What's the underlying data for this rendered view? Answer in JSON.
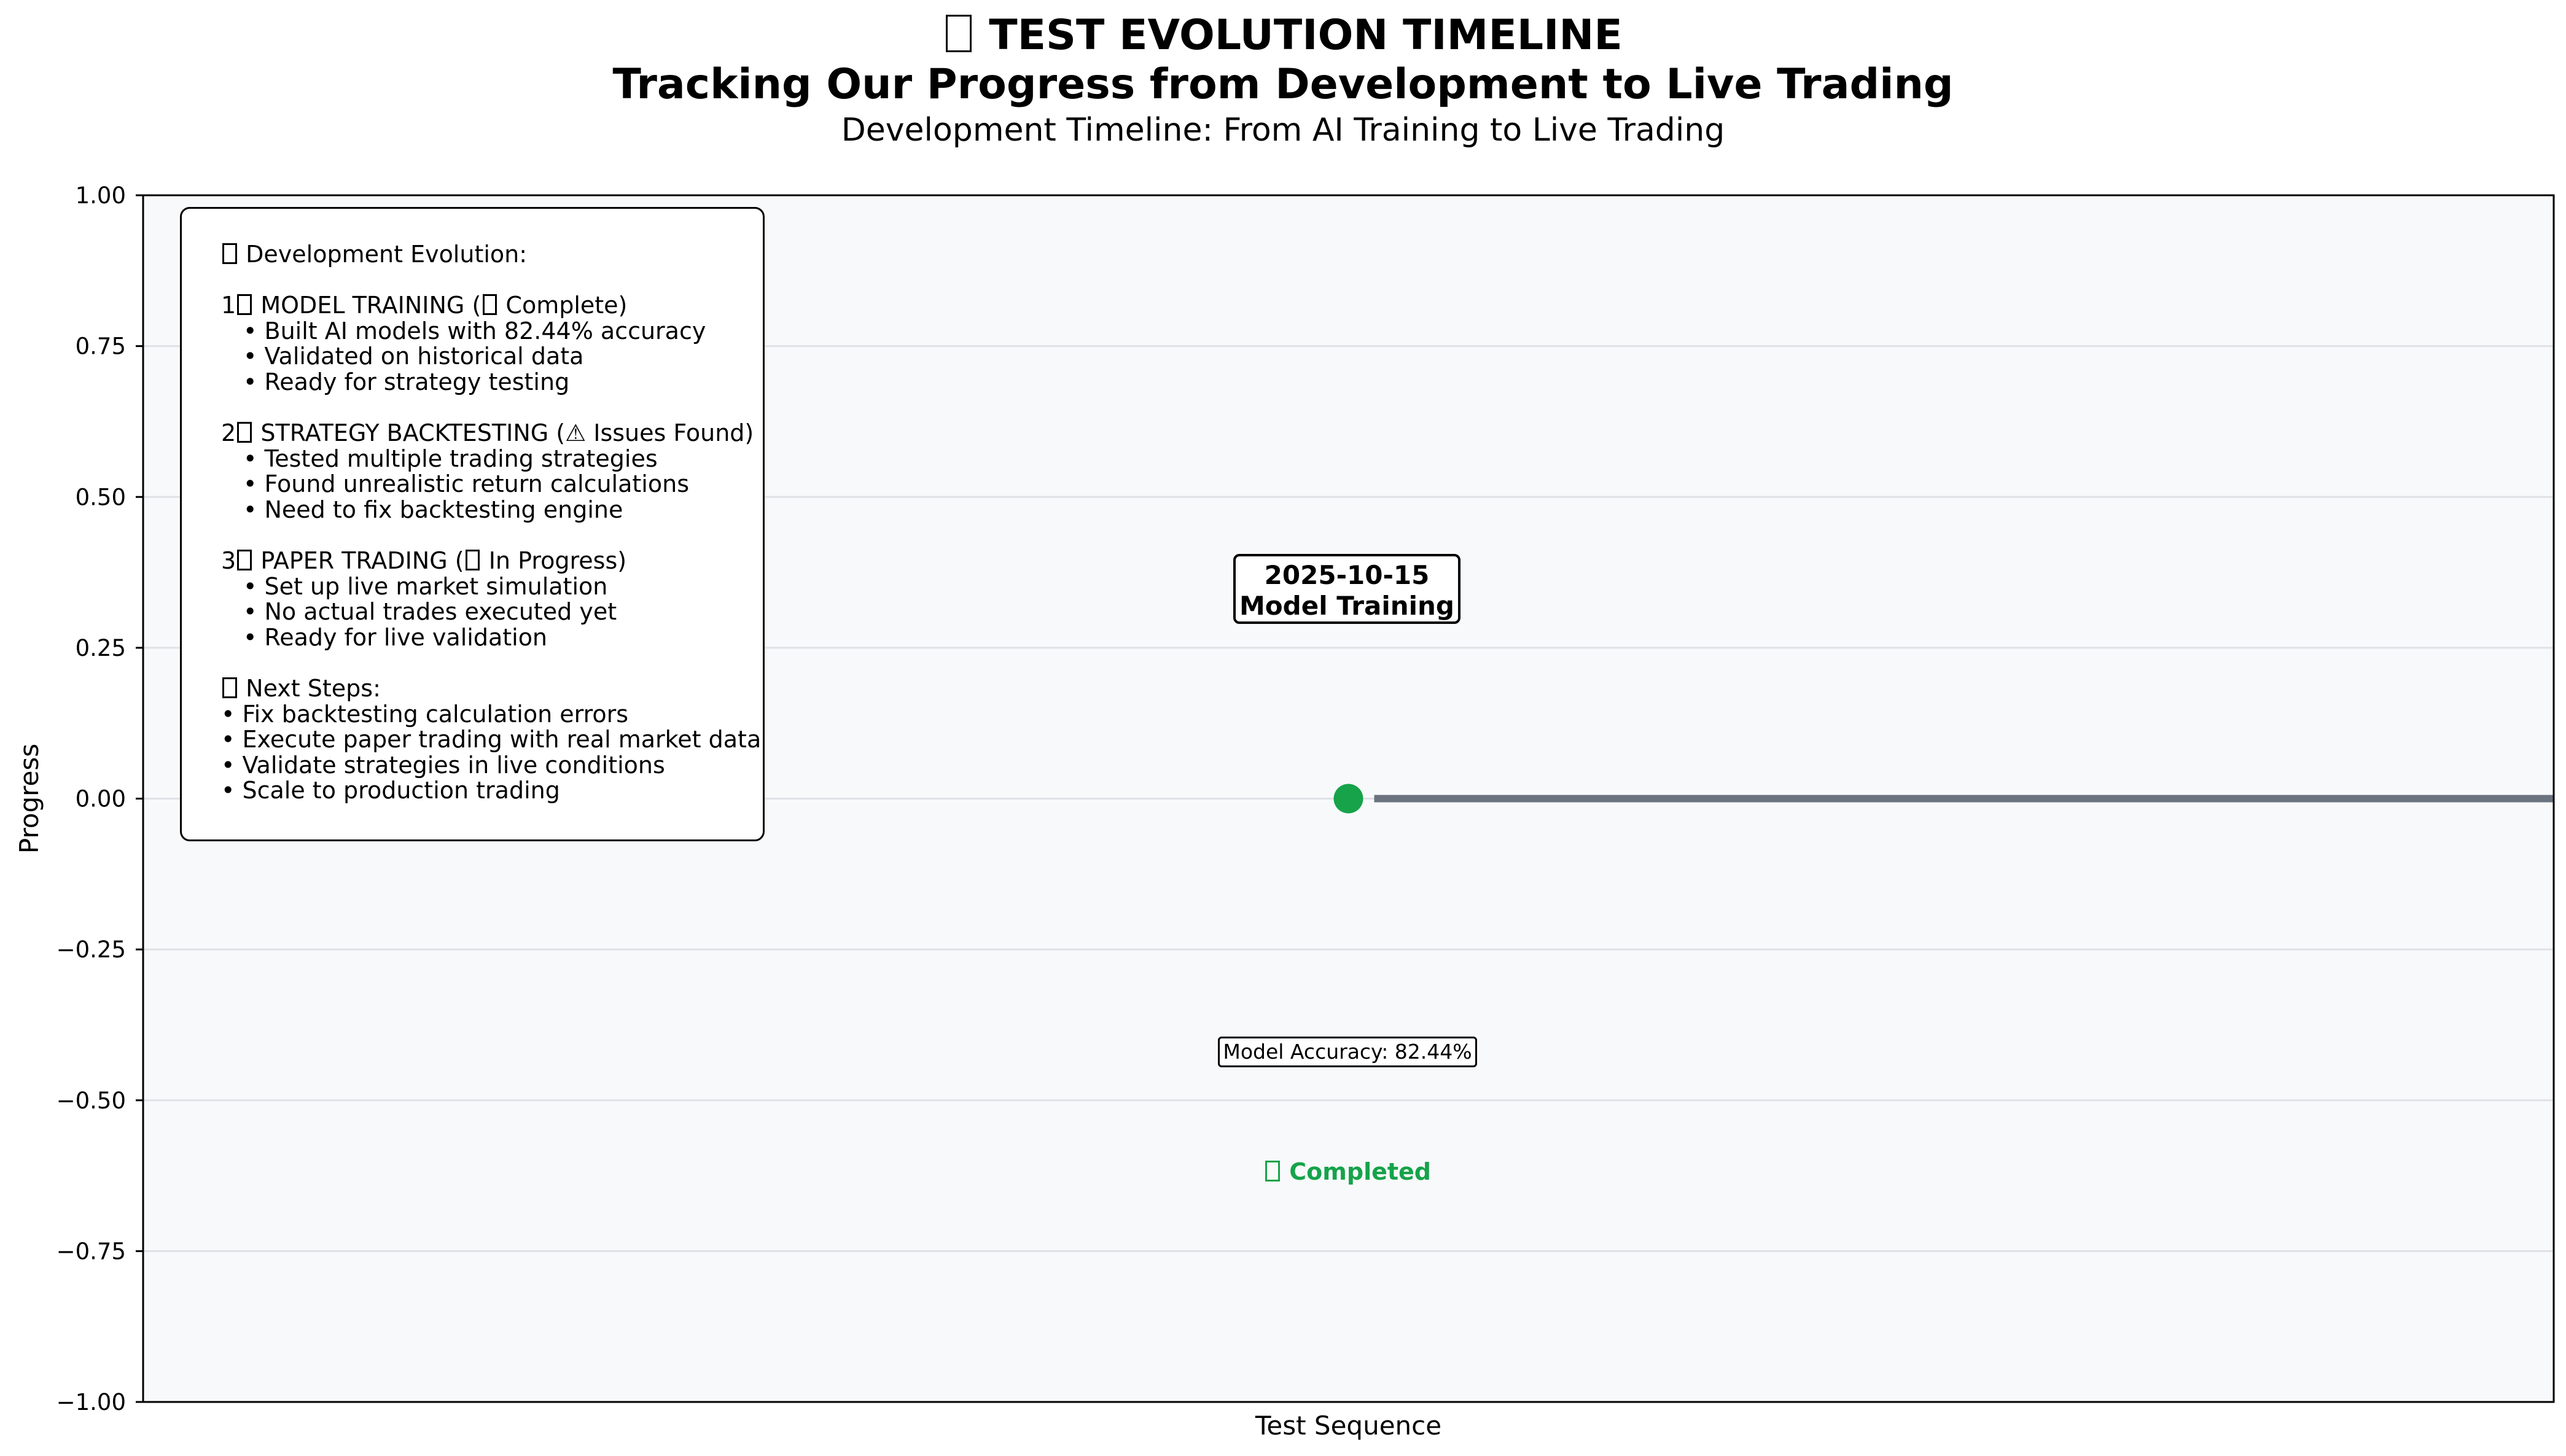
{
  "title_lines": [
    "TEST EVOLUTION TIMELINE",
    "Tracking Our Progress from Development to Live Trading"
  ],
  "subtitle": "Development Timeline: From AI Training to Live Trading",
  "colors": {
    "plot_background": "#f8f9fa",
    "timeline": "#6b7280",
    "completed": "#16a34a",
    "grid": "#dfe1e5"
  },
  "chart_data": {
    "type": "line",
    "xlabel": "Test Sequence",
    "ylabel": "Progress",
    "ylim": [
      -1.0,
      1.0
    ],
    "yticks": [
      1.0,
      0.75,
      0.5,
      0.25,
      0.0,
      -0.25,
      -0.5,
      -0.75,
      -1.0
    ],
    "ytick_labels": [
      "1.00",
      "0.75",
      "0.50",
      "0.25",
      "0.00",
      "−0.25",
      "−0.50",
      "−0.75",
      "−1.00"
    ],
    "grid": "horizontal",
    "points": [
      {
        "x": "2025-10-15",
        "y": 0.0,
        "date": "2025-10-15",
        "phase": "Model Training",
        "metric": "Model Accuracy: 82.44%",
        "status": "Completed"
      }
    ]
  },
  "info_box": {
    "lines": [
      {
        "text": "Development Evolution:",
        "icon": true,
        "sub": false
      },
      {
        "gap": true
      },
      {
        "text": "MODEL TRAINING (",
        "prefix": "1",
        "icon": true,
        "suffix_icon": true,
        "suffix": " Complete)",
        "sub": false
      },
      {
        "text": "• Built AI models with 82.44% accuracy",
        "sub": true
      },
      {
        "text": "• Validated on historical data",
        "sub": true
      },
      {
        "text": "• Ready for strategy testing",
        "sub": true
      },
      {
        "gap": true
      },
      {
        "text": "STRATEGY BACKTESTING (⚠ Issues Found)",
        "prefix": "2",
        "icon": true,
        "sub": false
      },
      {
        "text": "• Tested multiple trading strategies",
        "sub": true
      },
      {
        "text": "• Found unrealistic return calculations",
        "sub": true
      },
      {
        "text": "• Need to fix backtesting engine",
        "sub": true
      },
      {
        "gap": true
      },
      {
        "text": "PAPER TRADING (",
        "prefix": "3",
        "icon": true,
        "suffix_icon": true,
        "suffix": " In Progress)",
        "sub": false
      },
      {
        "text": "• Set up live market simulation",
        "sub": true
      },
      {
        "text": "• No actual trades executed yet",
        "sub": true
      },
      {
        "text": "• Ready for live validation",
        "sub": true
      },
      {
        "gap": true
      },
      {
        "text": "Next Steps:",
        "icon": true,
        "sub": false
      },
      {
        "text": "• Fix backtesting calculation errors",
        "sub": false
      },
      {
        "text": "• Execute paper trading with real market data",
        "sub": false
      },
      {
        "text": "• Validate strategies in live conditions",
        "sub": false
      },
      {
        "text": "• Scale to production trading",
        "sub": false
      }
    ]
  }
}
